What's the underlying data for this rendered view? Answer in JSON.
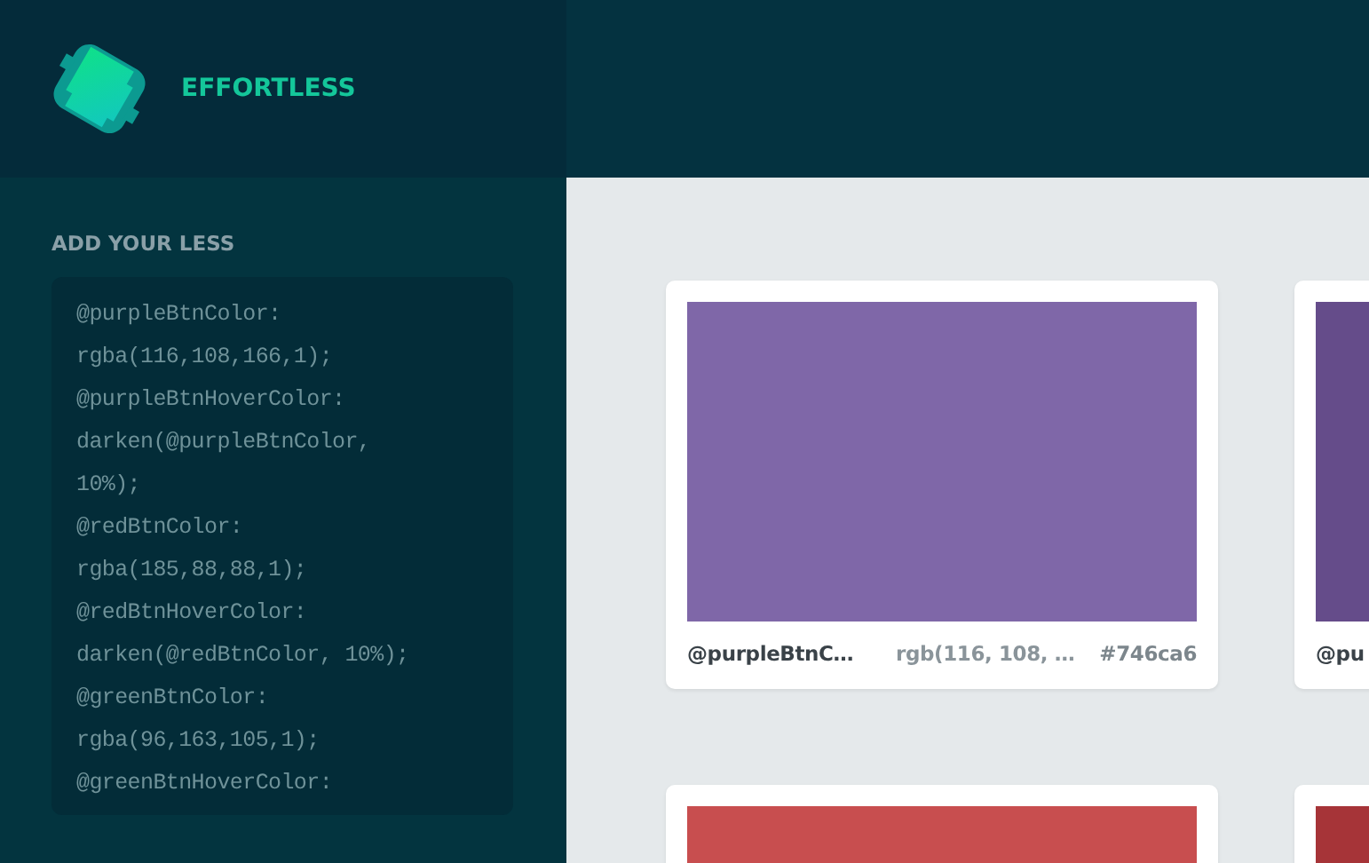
{
  "brand": {
    "name": "EFFORTLESS"
  },
  "sidebar": {
    "heading": "ADD YOUR LESS",
    "code_lines": [
      "@purpleBtnColor:",
      "rgba(116,108,166,1);",
      "@purpleBtnHoverColor:",
      "darken(@purpleBtnColor,",
      "10%);",
      "@redBtnColor:",
      "rgba(185,88,88,1);",
      "@redBtnHoverColor:",
      "darken(@redBtnColor, 10%);",
      "@greenBtnColor:",
      "rgba(96,163,105,1);",
      "@greenBtnHoverColor:"
    ]
  },
  "swatches": [
    {
      "color": "#7f67a8",
      "name": "@purpleBtnC…",
      "rgb": "rgb(116, 108, …",
      "hex": "#746ca6"
    },
    {
      "color": "#654c8a",
      "name": "@pu"
    },
    {
      "color": "#c84e4f"
    },
    {
      "color": "#a63438"
    }
  ]
}
